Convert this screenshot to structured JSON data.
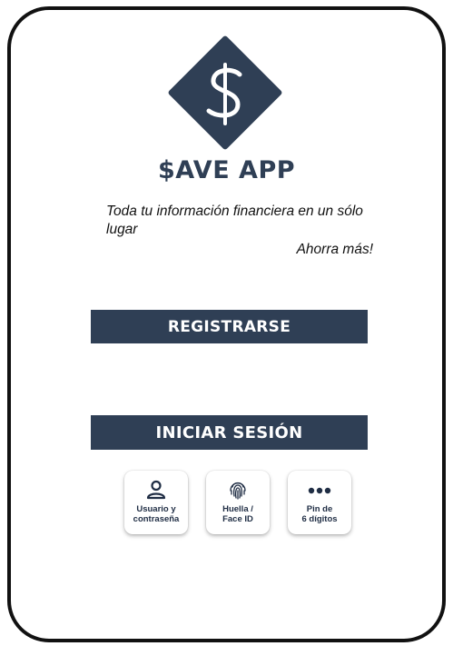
{
  "app": {
    "title": "$AVE APP",
    "logo_glyph": "$",
    "tagline": "Toda tu información financiera en un sólo lugar",
    "slogan": "Ahorra más!"
  },
  "actions": {
    "register_label": "REGISTRARSE",
    "login_label": "INICIAR SESIÓN"
  },
  "auth_methods": [
    {
      "label": "Usuario y\ncontraseña",
      "icon": "user-icon"
    },
    {
      "label": "Huella /\nFace ID",
      "icon": "fingerprint-icon"
    },
    {
      "label": "Pin de\n6 dígitos",
      "icon": "dots-icon"
    }
  ],
  "colors": {
    "brand": "#2f3f55",
    "icon_dark": "#1f2d44"
  }
}
